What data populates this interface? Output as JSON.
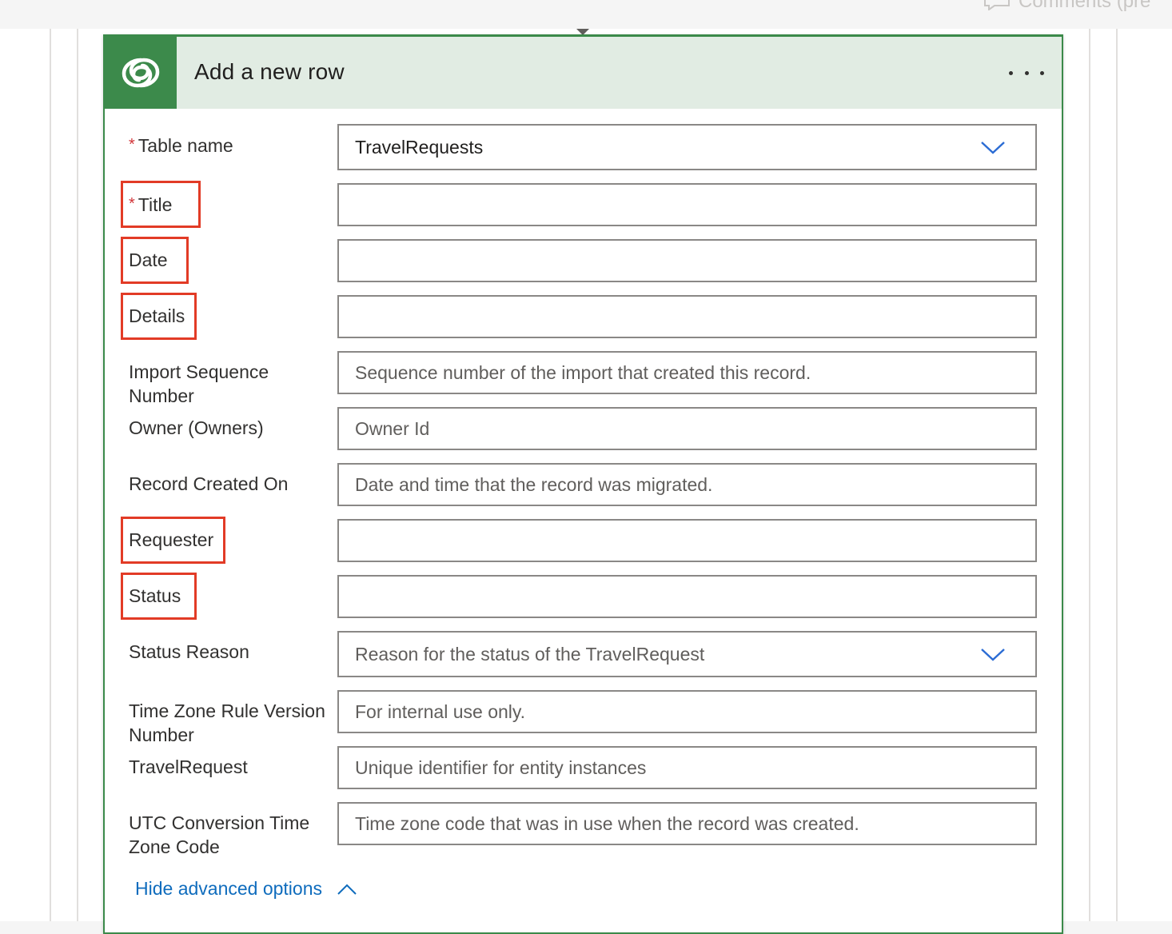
{
  "topbar": {
    "comments_label": "Comments (pre"
  },
  "card": {
    "title": "Add a new row",
    "icon": "dataverse-logo-icon",
    "more_icon": "more-ellipsis-icon"
  },
  "fields": [
    {
      "label": "Table name",
      "required": true,
      "value": "TravelRequests",
      "placeholder": "",
      "dropdown": true,
      "highlighted": false
    },
    {
      "label": "Title",
      "required": true,
      "value": "",
      "placeholder": "",
      "dropdown": false,
      "highlighted": true
    },
    {
      "label": "Date",
      "required": false,
      "value": "",
      "placeholder": "",
      "dropdown": false,
      "highlighted": true
    },
    {
      "label": "Details",
      "required": false,
      "value": "",
      "placeholder": "",
      "dropdown": false,
      "highlighted": true
    },
    {
      "label": "Import Sequence Number",
      "required": false,
      "value": "",
      "placeholder": "Sequence number of the import that created this record.",
      "dropdown": false,
      "highlighted": false
    },
    {
      "label": "Owner (Owners)",
      "required": false,
      "value": "",
      "placeholder": "Owner Id",
      "dropdown": false,
      "highlighted": false
    },
    {
      "label": "Record Created On",
      "required": false,
      "value": "",
      "placeholder": "Date and time that the record was migrated.",
      "dropdown": false,
      "highlighted": false
    },
    {
      "label": "Requester",
      "required": false,
      "value": "",
      "placeholder": "",
      "dropdown": false,
      "highlighted": true
    },
    {
      "label": "Status",
      "required": false,
      "value": "",
      "placeholder": "",
      "dropdown": false,
      "highlighted": true
    },
    {
      "label": "Status Reason",
      "required": false,
      "value": "",
      "placeholder": "Reason for the status of the TravelRequest",
      "dropdown": true,
      "highlighted": false
    },
    {
      "label": "Time Zone Rule Version Number",
      "required": false,
      "value": "",
      "placeholder": "For internal use only.",
      "dropdown": false,
      "highlighted": false
    },
    {
      "label": "TravelRequest",
      "required": false,
      "value": "",
      "placeholder": "Unique identifier for entity instances",
      "dropdown": false,
      "highlighted": false
    },
    {
      "label": "UTC Conversion Time Zone Code",
      "required": false,
      "value": "",
      "placeholder": "Time zone code that was in use when the record was created.",
      "dropdown": false,
      "highlighted": false
    }
  ],
  "advanced": {
    "label": "Hide advanced options",
    "icon": "chevron-up-icon"
  },
  "colors": {
    "header_bg": "#e1ece3",
    "brand_green": "#3c8a4b",
    "highlight_red": "#e23b26",
    "link_blue": "#0f6cbd",
    "required_red": "#d13438"
  }
}
